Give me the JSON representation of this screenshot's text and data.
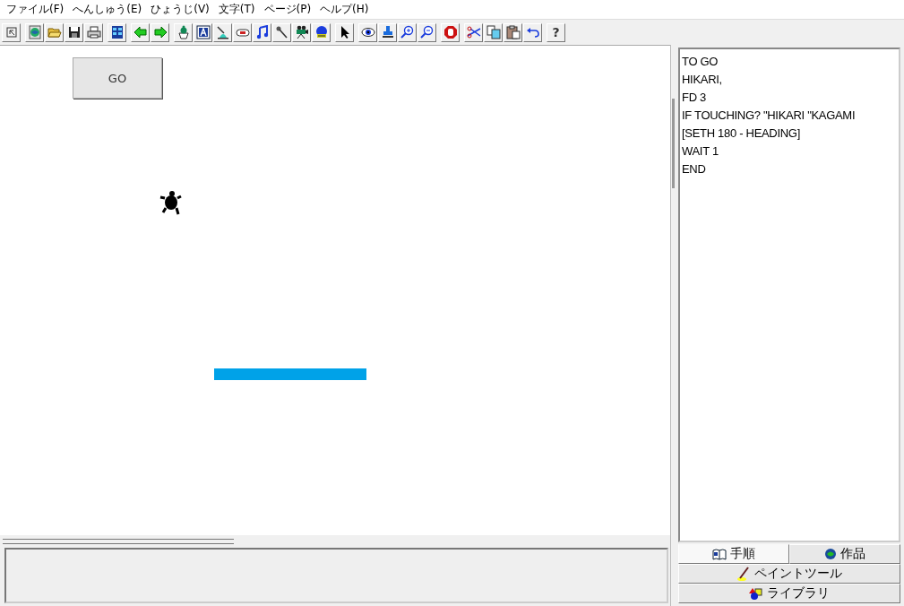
{
  "menu": [
    "ファイル(F)",
    "へんしゅう(E)",
    "ひょうじ(V)",
    "文字(T)",
    "ページ(P)",
    "ヘルプ(H)"
  ],
  "toolbar": {
    "help_glyph": "?"
  },
  "canvas": {
    "go_button": "GO"
  },
  "procedure": {
    "lines": [
      "TO GO",
      "HIKARI,",
      "FD 3",
      "IF TOUCHING? \"HIKARI \"KAGAMI",
      "[SETH 180 - HEADING]",
      "WAIT 1",
      "END"
    ]
  },
  "tabs": [
    {
      "label": "手順",
      "selected": true
    },
    {
      "label": "作品",
      "selected": false
    },
    {
      "label": "ペイントツール",
      "selected": false
    },
    {
      "label": "ライブラリ",
      "selected": false
    }
  ]
}
